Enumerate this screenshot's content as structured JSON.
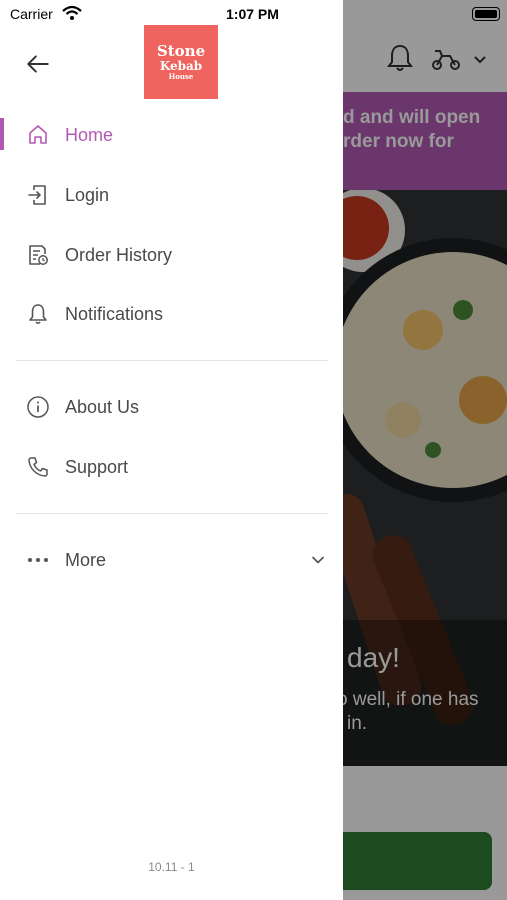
{
  "status_bar": {
    "carrier": "Carrier",
    "time": "1:07 PM"
  },
  "colors": {
    "accent": "#b25ab3",
    "logo_bg": "#f0645f",
    "cta_green": "#2e7d32"
  },
  "drawer": {
    "logo": {
      "text_1": "Stone",
      "text_2": "Kebab",
      "text_3": "House"
    },
    "items": [
      {
        "label": "Home",
        "icon": "home-icon",
        "active": true
      },
      {
        "label": "Login",
        "icon": "login-icon"
      },
      {
        "label": "Order History",
        "icon": "order-history-icon"
      },
      {
        "label": "Notifications",
        "icon": "bell-icon"
      },
      {
        "label": "About Us",
        "icon": "info-icon"
      },
      {
        "label": "Support",
        "icon": "phone-icon"
      },
      {
        "label": "More",
        "icon": "more-dots-icon"
      }
    ],
    "version": "10.11 - 1"
  },
  "background": {
    "banner_line_1": "d and will open",
    "banner_line_2": "rder now for",
    "hero_title": "day!",
    "hero_sub_1": "o well, if one has",
    "hero_sub_2": "in."
  }
}
